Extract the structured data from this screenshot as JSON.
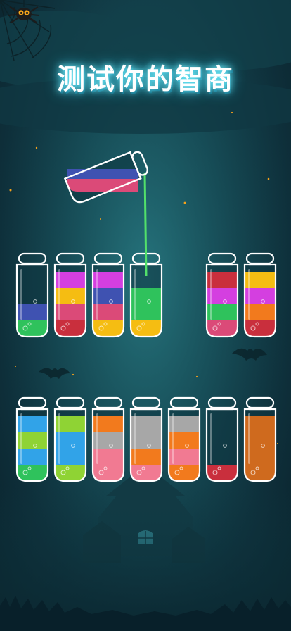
{
  "title": "测试你的智商",
  "colors": {
    "blue": "#3f52b1",
    "green": "#2fc25c",
    "red": "#c92f3d",
    "pink": "#db4a78",
    "yellow": "#f5bd12",
    "magenta": "#d43fe0",
    "orange": "#f27a1d",
    "grey": "#a7a7a7",
    "skyblue": "#31a3e8",
    "lime": "#8fd334",
    "salmon": "#f17a92",
    "bronze": "#cf6a1e",
    "stream": "#52e06a"
  },
  "tubes_top": [
    [
      "green",
      "blue",
      "empty",
      "empty"
    ],
    [
      "red",
      "pink",
      "yellow",
      "magenta"
    ],
    [
      "yellow",
      "pink",
      "blue",
      "magenta"
    ],
    [
      "yellow",
      "green",
      "green",
      "empty"
    ],
    null,
    [
      "pink",
      "green",
      "magenta",
      "red"
    ],
    [
      "red",
      "orange",
      "magenta",
      "yellow"
    ]
  ],
  "tubes_bottom": [
    [
      "green",
      "skyblue",
      "lime",
      "skyblue"
    ],
    [
      "lime",
      "skyblue",
      "skyblue",
      "lime"
    ],
    [
      "salmon",
      "salmon",
      "grey",
      "orange"
    ],
    [
      "salmon",
      "orange",
      "grey",
      "grey"
    ],
    [
      "orange",
      "salmon",
      "orange",
      "grey"
    ],
    [
      "red",
      "empty",
      "empty",
      "empty"
    ],
    [
      "bronze",
      "bronze",
      "bronze",
      "bronze"
    ]
  ],
  "pouring_tube": [
    "pink",
    "blue"
  ],
  "icons": [
    "spider-icon",
    "spider-web-icon",
    "bat-icon",
    "haunted-house-icon"
  ]
}
